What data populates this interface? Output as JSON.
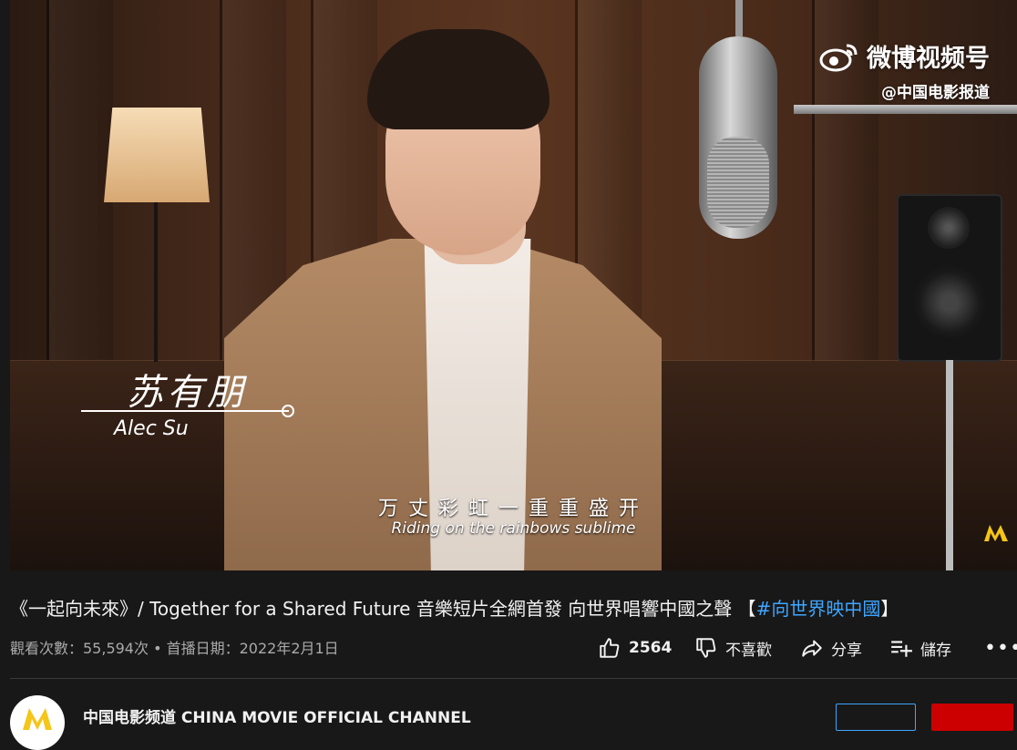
{
  "video": {
    "watermark_brand": "微博视频号",
    "watermark_handle": "@中国电影报道",
    "lower_third_name_cn": "苏有朋",
    "lower_third_name_en": "Alec Su",
    "subtitle_cn": "万丈彩虹一重重盛开",
    "subtitle_en": "Riding on the rainbows sublime"
  },
  "title": {
    "main": "《一起向未來》/ Together for a Shared Future 音樂短片全網首發 向世界唱響中國之聲 【",
    "hashtag": "#向世界映中國",
    "end": "】"
  },
  "meta": {
    "text": "觀看次數：55,594次 • 首播日期：2022年2月1日"
  },
  "actions": {
    "like_count": "2564",
    "dislike_label": "不喜歡",
    "share_label": "分享",
    "save_label": "儲存",
    "more_label": "•••"
  },
  "channel": {
    "name": "中国电影频道 CHINA MOVIE OFFICIAL CHANNEL"
  },
  "colors": {
    "background": "#181818",
    "link": "#3ea6ff",
    "subscribe": "#cc0000",
    "logo_yellow": "#f5c518"
  }
}
